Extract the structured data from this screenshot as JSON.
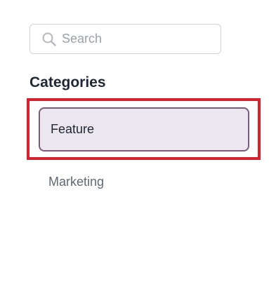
{
  "search": {
    "placeholder": "Search",
    "value": "",
    "icon": "search-icon"
  },
  "categories": {
    "heading": "Categories",
    "items": [
      {
        "label": "Feature",
        "selected": true
      },
      {
        "label": "Marketing",
        "selected": false
      }
    ]
  },
  "colors": {
    "highlight_border": "#d7212d",
    "selected_border": "#7c5a7e",
    "selected_background": "#ece6ee"
  }
}
